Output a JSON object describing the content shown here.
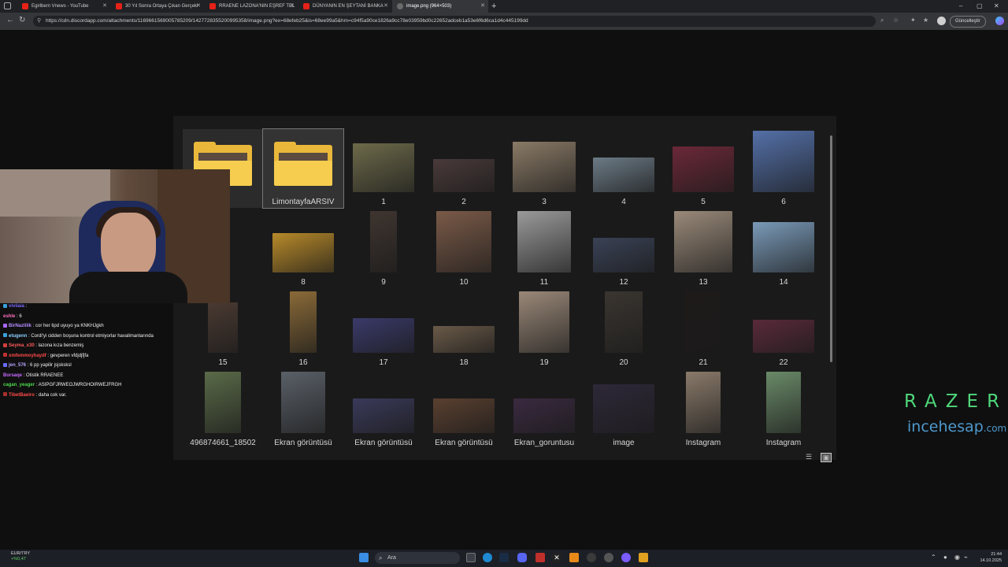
{
  "browser": {
    "tabs": [
      {
        "label": "Egirlbern Vnews - YouTube"
      },
      {
        "label": "30 Yıl Sonra Ortaya Çıkan Gerçekl"
      },
      {
        "label": "RRAENE LAZONA'NIN EŞREF TEL"
      },
      {
        "label": "DÜNYANIN EN ŞEYTANİ BANKA"
      },
      {
        "label": "image.png (964×503)"
      }
    ],
    "new_tab": "+",
    "url": "https://cdn.discordapp.com/attachments/1169661569005785209/1427728355200995358/image.png?ex=68efeb25&is=68ee99a5&hm=c94f5a90ce1826a9cc78e03959bd0c22652adceb1a53e6f6d6ca1d4c445199dd",
    "update_button": "Güncelleştir",
    "window_controls": {
      "minimize": "–",
      "maximize": "▢",
      "close": "✕"
    }
  },
  "file_grid": {
    "folders": [
      {
        "label": ""
      },
      {
        "label": "LimontayfaARSİV"
      }
    ],
    "items": [
      {
        "label": "1",
        "color": "#6d6a4a"
      },
      {
        "label": "2",
        "color": "#4a3a3a"
      },
      {
        "label": "3",
        "color": "#8a7a66"
      },
      {
        "label": "4",
        "color": "#6c7b86"
      },
      {
        "label": "5",
        "color": "#6b2838"
      },
      {
        "label": "6",
        "color": "#5470a8"
      },
      {
        "label": "8",
        "color": "#b88a2a"
      },
      {
        "label": "9",
        "color": "#3f3530"
      },
      {
        "label": "10",
        "color": "#7a5a48"
      },
      {
        "label": "11",
        "color": "#9a9a9a"
      },
      {
        "label": "12",
        "color": "#3a4256"
      },
      {
        "label": "13",
        "color": "#9a8a7a"
      },
      {
        "label": "14",
        "color": "#7a9ab8"
      },
      {
        "label": "15",
        "color": "#4a3a32"
      },
      {
        "label": "16",
        "color": "#8a6a38"
      },
      {
        "label": "17",
        "color": "#3a3a6a"
      },
      {
        "label": "18",
        "color": "#6a5a48"
      },
      {
        "label": "19",
        "color": "#9a8878"
      },
      {
        "label": "20",
        "color": "#3a3530"
      },
      {
        "label": "21",
        "color": "#1e1a1a"
      },
      {
        "label": "22",
        "color": "#5a2a3a"
      },
      {
        "label": "496874661_18502",
        "color": "#5a6a48"
      },
      {
        "label": "Ekran görüntüsü",
        "color": "#5a6068"
      },
      {
        "label": "Ekran görüntüsü",
        "color": "#3a3a5a"
      },
      {
        "label": "Ekran görüntüsü",
        "color": "#5a4030"
      },
      {
        "label": "Ekran_goruntusu",
        "color": "#3a2a40"
      },
      {
        "label": "image",
        "color": "#2e2838"
      },
      {
        "label": "Instagram",
        "color": "#8a7a6a"
      },
      {
        "label": "Instagram",
        "color": "#6a8a68"
      }
    ]
  },
  "chat": [
    {
      "user": "viviiaia",
      "msg": ":",
      "color": "#7b6cff",
      "badge": "#3aa0d8"
    },
    {
      "user": "eshle",
      "msg": ": 6",
      "color": "#ff6fbf",
      "badge": ""
    },
    {
      "user": "BirNazlilik",
      "msg": ": cor her tipd uyuyo ya KNKHJgkh",
      "color": "#b28cff",
      "badge": "#aa66ff"
    },
    {
      "user": "etugenn",
      "msg": ": Cordl'yi cidden boşuna kontrol etmiyorlar havalimanlarında",
      "color": "#8cd0ff",
      "badge": "#3aa0d8"
    },
    {
      "user": "Seyma_x30",
      "msg": ": lazona kıza benzemiş",
      "color": "#ff5a5a",
      "badge": "#d04040"
    },
    {
      "user": "xmfemmoyhaydf",
      "msg": ": gevperen vfdjdjfjfa",
      "color": "#ff4a4a",
      "badge": "#c03030"
    },
    {
      "user": "jen_576",
      "msg": ": 6 pp yapilir jsjsksksl",
      "color": "#b8a2ff",
      "badge": "#6a6aff"
    },
    {
      "user": "Borsaqe",
      "msg": ": Otistik RRAENEE",
      "color": "#c86aff",
      "badge": ""
    },
    {
      "user": "cagan_yeager",
      "msg": ": ASIPGFJRWEOJWRGHOIRWEJFRGH",
      "color": "#4cd94c",
      "badge": ""
    },
    {
      "user": "TibetBaeiro",
      "msg": ": daha cok var.",
      "color": "#ff4a4a",
      "badge": "#aa3030"
    }
  ],
  "watermark": {
    "razer": "RAZER",
    "site_main": "incehesap",
    "site_tld": ".com"
  },
  "taskbar": {
    "search_placeholder": "Ara",
    "ticker_pair": "EUR/TRY",
    "ticker_change": "+%0,47",
    "time": "21:44",
    "date": "14.10.2025"
  }
}
